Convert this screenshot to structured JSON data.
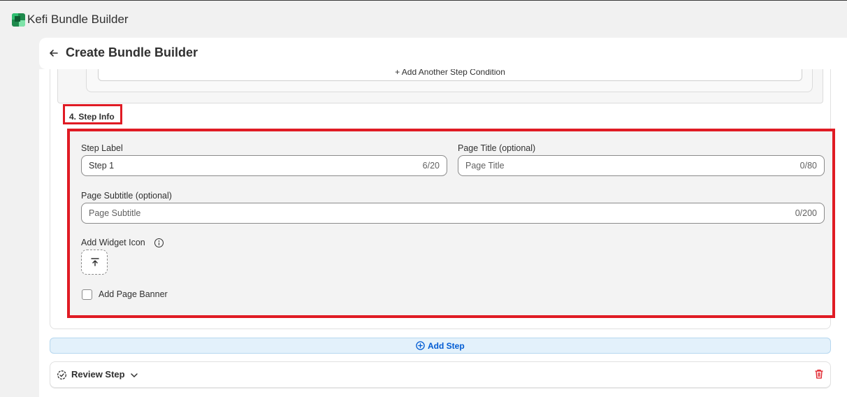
{
  "app": {
    "title": "Kefi Bundle Builder"
  },
  "header": {
    "back_icon": "arrow-left-icon",
    "title": "Create Bundle Builder"
  },
  "previous_section": {
    "add_condition_label": "+ Add Another Step Condition"
  },
  "step_info": {
    "heading": "4. Step Info",
    "step_label": {
      "label": "Step Label",
      "value": "Step 1",
      "counter": "6/20"
    },
    "page_title": {
      "label": "Page Title (optional)",
      "placeholder": "Page Title",
      "counter": "0/80"
    },
    "page_subtitle": {
      "label": "Page Subtitle (optional)",
      "placeholder": "Page Subtitle",
      "counter": "0/200"
    },
    "widget_icon": {
      "label": "Add Widget Icon",
      "info_icon": "info-icon",
      "upload_icon": "upload-icon"
    },
    "page_banner": {
      "label": "Add Page Banner",
      "checked": false
    }
  },
  "add_step": {
    "label": "Add Step",
    "icon": "plus-circle-icon"
  },
  "review_step": {
    "title": "Review Step",
    "icon": "review-gear-icon",
    "chevron": "chevron-down-icon",
    "delete_icon": "trash-icon"
  },
  "colors": {
    "highlight": "#e01b24",
    "accent_blue": "#005bd3",
    "danger": "#e01b24",
    "add_step_bg": "#e3f1fb"
  }
}
